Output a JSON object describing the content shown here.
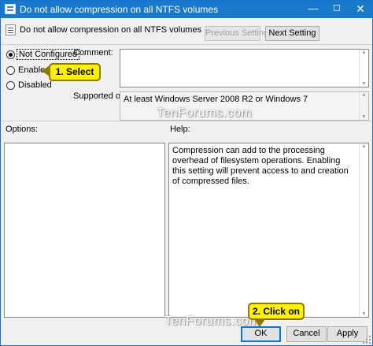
{
  "window": {
    "title": "Do not allow compression on all NTFS volumes",
    "minimize_glyph": "—",
    "maximize_glyph": "☐",
    "close_glyph": "✕"
  },
  "header": {
    "policy_name": "Do not allow compression on all NTFS volumes",
    "policy_icon": "policy-setting-icon",
    "previous_setting_label": "Previous Setting",
    "next_setting_label": "Next Setting"
  },
  "state_options": [
    {
      "label": "Not Configured",
      "checked": true
    },
    {
      "label": "Enabled",
      "checked": false
    },
    {
      "label": "Disabled",
      "checked": false
    }
  ],
  "comment": {
    "label": "Comment:",
    "value": ""
  },
  "supported_on": {
    "label": "Supported on:",
    "value": "At least Windows Server 2008 R2 or Windows 7"
  },
  "options": {
    "label": "Options:"
  },
  "help": {
    "label": "Help:",
    "text": "Compression can add to the processing overhead of filesystem operations.  Enabling this setting will prevent access to and creation of compressed files."
  },
  "footer": {
    "ok_label": "OK",
    "cancel_label": "Cancel",
    "apply_label": "Apply"
  },
  "annotations": {
    "callout_select": "1. Select",
    "callout_click": "2. Click on",
    "callout_color": "#fff200"
  },
  "watermark": {
    "text": "TenForums.com"
  },
  "colors": {
    "titlebar": "#1979ca",
    "focus_border": "#0078d7",
    "dialog_bg": "#f0f0f0"
  }
}
